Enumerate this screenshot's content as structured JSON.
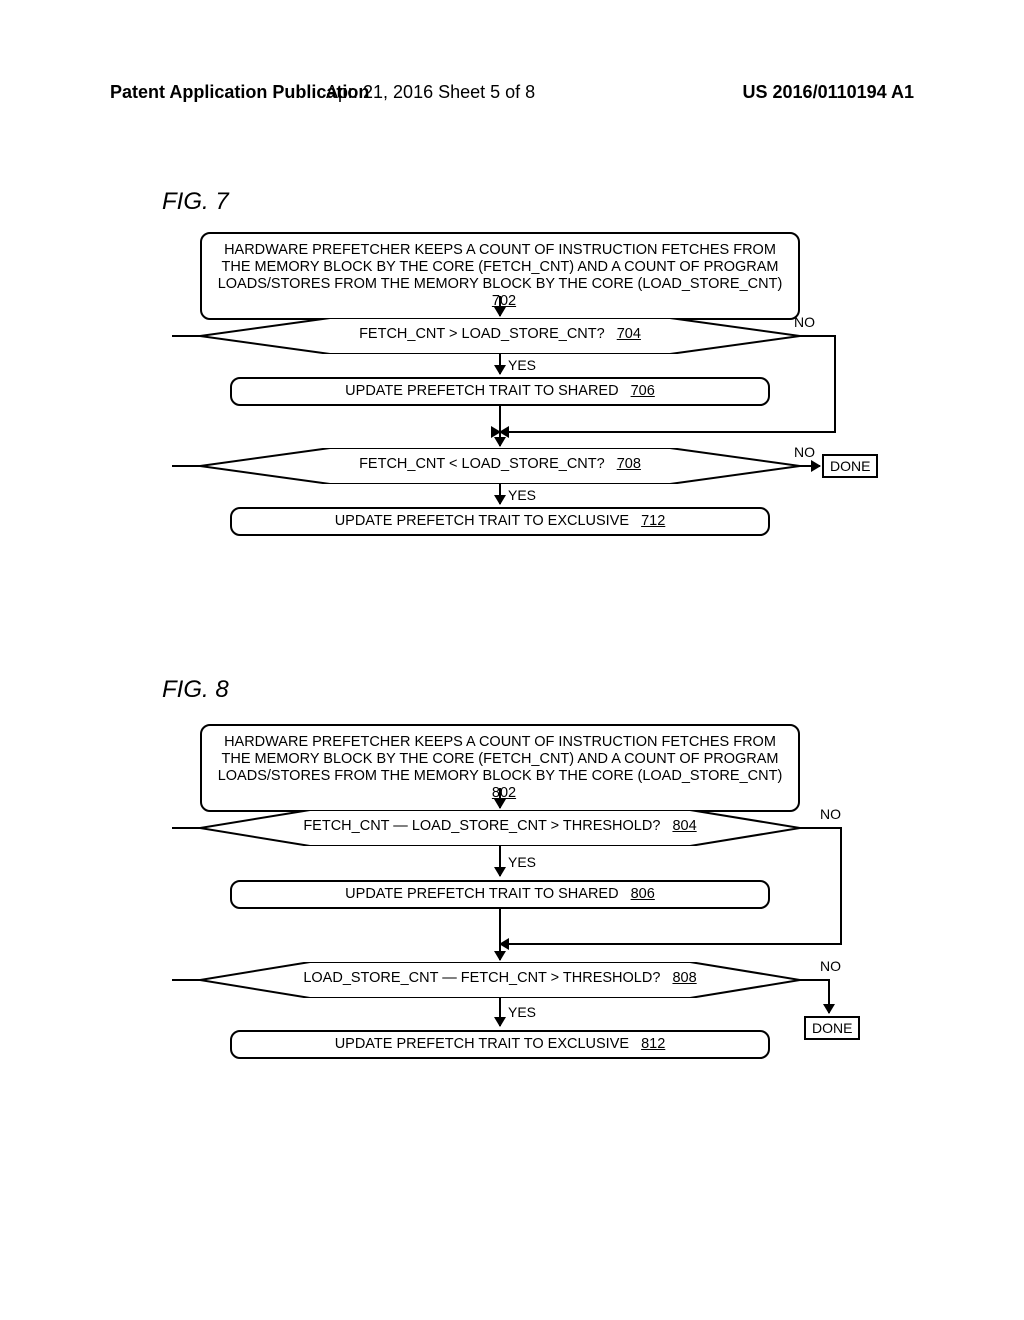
{
  "header": {
    "left": "Patent Application Publication",
    "center": "Apr. 21, 2016  Sheet 5 of 8",
    "right": "US 2016/0110194 A1"
  },
  "fig7": {
    "label": "FIG. 7",
    "start": "HARDWARE PREFETCHER KEEPS A COUNT OF INSTRUCTION FETCHES FROM THE MEMORY BLOCK BY THE CORE (FETCH_CNT) AND A COUNT OF PROGRAM LOADS/STORES FROM THE  MEMORY BLOCK BY THE CORE (LOAD_STORE_CNT)",
    "start_ref": "702",
    "d1": "FETCH_CNT > LOAD_STORE_CNT?",
    "d1_ref": "704",
    "p1": "UPDATE PREFETCH TRAIT TO SHARED",
    "p1_ref": "706",
    "d2": "FETCH_CNT < LOAD_STORE_CNT?",
    "d2_ref": "708",
    "p2": "UPDATE PREFETCH TRAIT TO EXCLUSIVE",
    "p2_ref": "712",
    "yes": "YES",
    "no": "NO",
    "done": "DONE"
  },
  "fig8": {
    "label": "FIG. 8",
    "start": "HARDWARE PREFETCHER KEEPS A COUNT OF INSTRUCTION FETCHES FROM THE MEMORY BLOCK BY THE CORE (FETCH_CNT) AND A COUNT OF PROGRAM LOADS/STORES FROM THE  MEMORY BLOCK BY THE CORE (LOAD_STORE_CNT)",
    "start_ref": "802",
    "d1": "FETCH_CNT — LOAD_STORE_CNT > THRESHOLD?",
    "d1_ref": "804",
    "p1": "UPDATE PREFETCH TRAIT TO SHARED",
    "p1_ref": "806",
    "d2": "LOAD_STORE_CNT — FETCH_CNT > THRESHOLD?",
    "d2_ref": "808",
    "p2": "UPDATE PREFETCH TRAIT TO EXCLUSIVE",
    "p2_ref": "812",
    "yes": "YES",
    "no": "NO",
    "done": "DONE"
  }
}
